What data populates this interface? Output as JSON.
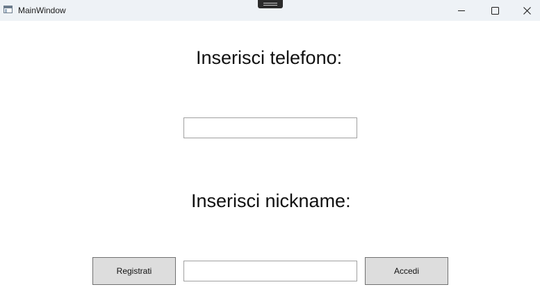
{
  "window": {
    "title": "MainWindow",
    "icon": "app-window-icon",
    "controls": {
      "minimize_icon": "minimize-icon",
      "maximize_icon": "maximize-icon",
      "close_icon": "close-icon"
    }
  },
  "form": {
    "phone_label": "Inserisci telefono:",
    "phone_value": "",
    "nickname_label": "Inserisci nickname:",
    "nickname_value": ""
  },
  "buttons": {
    "register_label": "Registrati",
    "login_label": "Accedi"
  },
  "colors": {
    "titlebar_bg": "#eef2f6",
    "button_bg": "#dddddd",
    "button_border": "#707070",
    "textbox_border": "#a0a0a0"
  }
}
